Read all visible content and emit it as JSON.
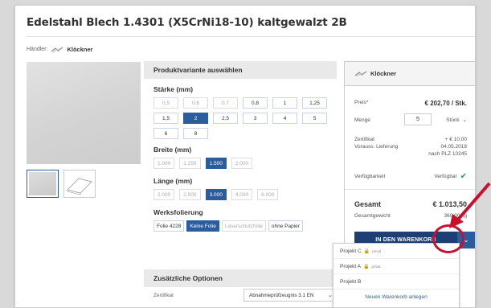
{
  "title": "Edelstahl Blech 1.4301 (X5CrNi18-10) kaltgewalzt 2B",
  "dealer": {
    "label": "Händler:",
    "name": "Klöckner"
  },
  "variant": {
    "header": "Produktvariante auswählen",
    "staerke": {
      "label": "Stärke (mm)",
      "row1": [
        "0,5",
        "0,6",
        "0,7",
        "0,8",
        "1",
        "1,25"
      ],
      "row2": [
        "1,5",
        "2",
        "2,5",
        "3",
        "4",
        "5"
      ],
      "row3": [
        "6",
        "8"
      ],
      "selected": "2"
    },
    "breite": {
      "label": "Breite (mm)",
      "options": [
        "1.000",
        "1.250",
        "1.500",
        "2.000"
      ],
      "selected": "1.500"
    },
    "laenge": {
      "label": "Länge (mm)",
      "options": [
        "2.000",
        "2.500",
        "3.000",
        "4.000",
        "6.000"
      ],
      "selected": "3.000"
    },
    "folierung": {
      "label": "Werksfolierung",
      "options": [
        "Folie 4228",
        "Keine Folie",
        "Laserschutzfolie",
        "ohne Papier"
      ],
      "selected": "Keine Folie"
    }
  },
  "extra": {
    "header": "Zusätzliche Optionen",
    "zert_label": "Zertifikat",
    "zert_value": "Abnahmeprüfzeugnis 3.1 EN"
  },
  "panel": {
    "vendor": "Klöckner",
    "preis_label": "Preis*",
    "preis": "€ 202,70 / Stk.",
    "menge_label": "Menge",
    "menge": "5",
    "unit": "Stück",
    "zert_label": "Zertifikat",
    "zert_value": "+ € 10,00",
    "liefer_label": "Vorauss. Lieferung",
    "liefer_date": "04.05.2018",
    "liefer_plz": "nach PLZ 10245",
    "verf_label": "Verfügbarkeit",
    "verf_value": "Verfügbar",
    "gesamt_label": "Gesamt",
    "gesamt": "€ 1.013,50",
    "gewicht_label": "Gesamtgewicht",
    "gewicht": "360,00 kg",
    "cart_label": "IN DEN WARENKORB"
  },
  "dropdown": {
    "items": [
      {
        "label": "Projekt C",
        "tag": "privat"
      },
      {
        "label": "Projekt A",
        "tag": "privat"
      },
      {
        "label": "Projekt B",
        "tag": ""
      }
    ],
    "new_cart": "Neuen Warenkorb anlegen"
  },
  "colors": {
    "primary": "#2b5c9e",
    "cart": "#1e3f73",
    "accent": "#c8102e",
    "ok": "#2e9a3f"
  }
}
